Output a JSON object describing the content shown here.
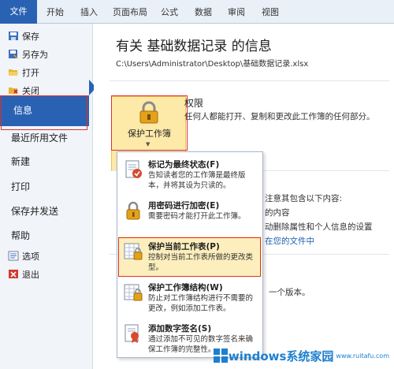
{
  "tabs": [
    "文件",
    "开始",
    "插入",
    "页面布局",
    "公式",
    "数据",
    "审阅",
    "视图"
  ],
  "sidebar": {
    "small_items": [
      "保存",
      "另存为",
      "打开",
      "关闭"
    ],
    "active": "信息",
    "big_items": [
      "最近所用文件",
      "新建",
      "打印",
      "保存并发送",
      "帮助"
    ],
    "bottom_items": [
      "选项",
      "退出"
    ]
  },
  "info": {
    "title": "有关 基础数据记录 的信息",
    "path": "C:\\Users\\Administrator\\Desktop\\基础数据记录.xlsx",
    "permissions_title": "权限",
    "permissions_desc": "任何人都能打开、复制和更改此工作簿的任何部分。",
    "protect_button": "保护工作簿",
    "behind_texts": [
      "注意其包含以下内容:",
      "的内容",
      "动删除属性和个人信息的设置",
      "在您的文件中",
      "一个版本。"
    ]
  },
  "menu": [
    {
      "title": "标记为最终状态(F)",
      "desc": "告知读者您的工作簿是最终版本，并将其设为只读的。"
    },
    {
      "title": "用密码进行加密(E)",
      "desc": "需要密码才能打开此工作簿。"
    },
    {
      "title": "保护当前工作表(P)",
      "desc": "控制对当前工作表所做的更改类型。"
    },
    {
      "title": "保护工作簿结构(W)",
      "desc": "防止对工作簿结构进行不需要的更改，例如添加工作表。"
    },
    {
      "title": "添加数字签名(S)",
      "desc": "通过添加不可见的数字签名来确保工作簿的完整性。"
    }
  ],
  "watermark": {
    "title": "windows系统家园",
    "site": "www.ruitafu.com"
  },
  "colors": {
    "accent": "#2a62b3",
    "highlight": "#fcefbd",
    "annotation": "#e0302a"
  }
}
